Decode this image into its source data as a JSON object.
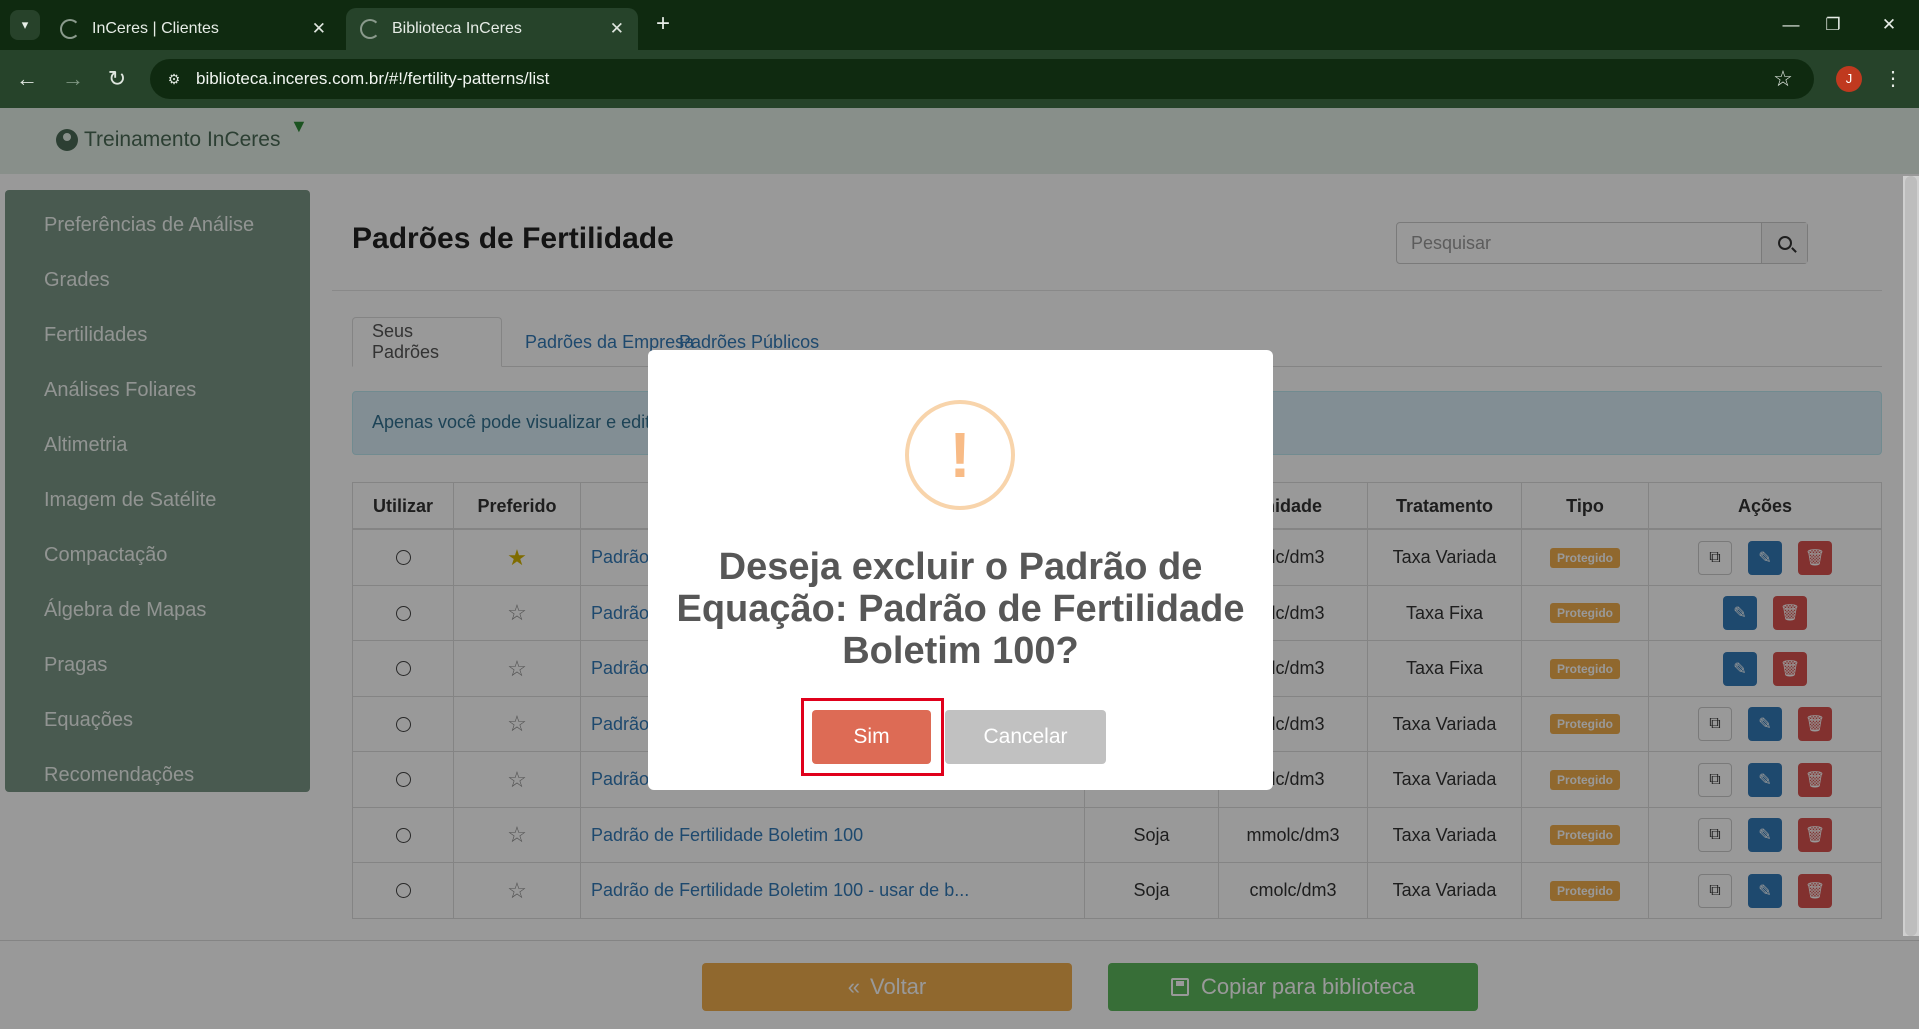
{
  "browser": {
    "tabs": [
      {
        "title": "InCeres | Clientes"
      },
      {
        "title": "Biblioteca InCeres"
      }
    ],
    "url": "biblioteca.inceres.com.br/#!/fertility-patterns/list",
    "profile_initial": "J"
  },
  "app": {
    "user_name": "Treinamento InCeres",
    "sidebar": [
      "Preferências de Análise",
      "Grades",
      "Fertilidades",
      "Análises Foliares",
      "Altimetria",
      "Imagem de Satélite",
      "Compactação",
      "Álgebra de Mapas",
      "Pragas",
      "Equações",
      "Recomendações"
    ],
    "page_title": "Padrões de Fertilidade",
    "search_placeholder": "Pesquisar",
    "tabs": [
      "Seus Padrões",
      "Padrões da Empresa",
      "Padrões Públicos"
    ],
    "alert": "Apenas você pode visualizar e edita",
    "table": {
      "headers": {
        "util": "Utilizar",
        "pref": "Preferido",
        "unid": "nidade",
        "trat": "Tratamento",
        "tipo": "Tipo",
        "acao": "Ações"
      },
      "rows": [
        {
          "name": "Padrão",
          "cult": "",
          "unid": "olc/dm3",
          "trat": "Taxa Variada",
          "tipo": "Protegido"
        },
        {
          "name": "Padrão",
          "cult": "",
          "unid": "olc/dm3",
          "trat": "Taxa Fixa",
          "tipo": "Protegido"
        },
        {
          "name": "Padrão",
          "cult": "",
          "unid": "olc/dm3",
          "trat": "Taxa Fixa",
          "tipo": "Protegido"
        },
        {
          "name": "Padrão",
          "cult": "",
          "unid": "olc/dm3",
          "trat": "Taxa Variada",
          "tipo": "Protegido"
        },
        {
          "name": "Padrão",
          "cult": "",
          "unid": "olc/dm3",
          "trat": "Taxa Variada",
          "tipo": "Protegido"
        },
        {
          "name": "Padrão de Fertilidade Boletim 100",
          "cult": "Soja",
          "unid": "mmolc/dm3",
          "trat": "Taxa Variada",
          "tipo": "Protegido"
        },
        {
          "name": "Padrão de Fertilidade Boletim 100 - usar de b...",
          "cult": "Soja",
          "unid": "cmolc/dm3",
          "trat": "Taxa Variada",
          "tipo": "Protegido"
        }
      ]
    },
    "footer": {
      "back": "Voltar",
      "copy": "Copiar para biblioteca"
    }
  },
  "modal": {
    "message": "Deseja excluir o Padrão de Equação: Padrão de Fertilidade Boletim 100?",
    "confirm": "Sim",
    "cancel": "Cancelar"
  }
}
